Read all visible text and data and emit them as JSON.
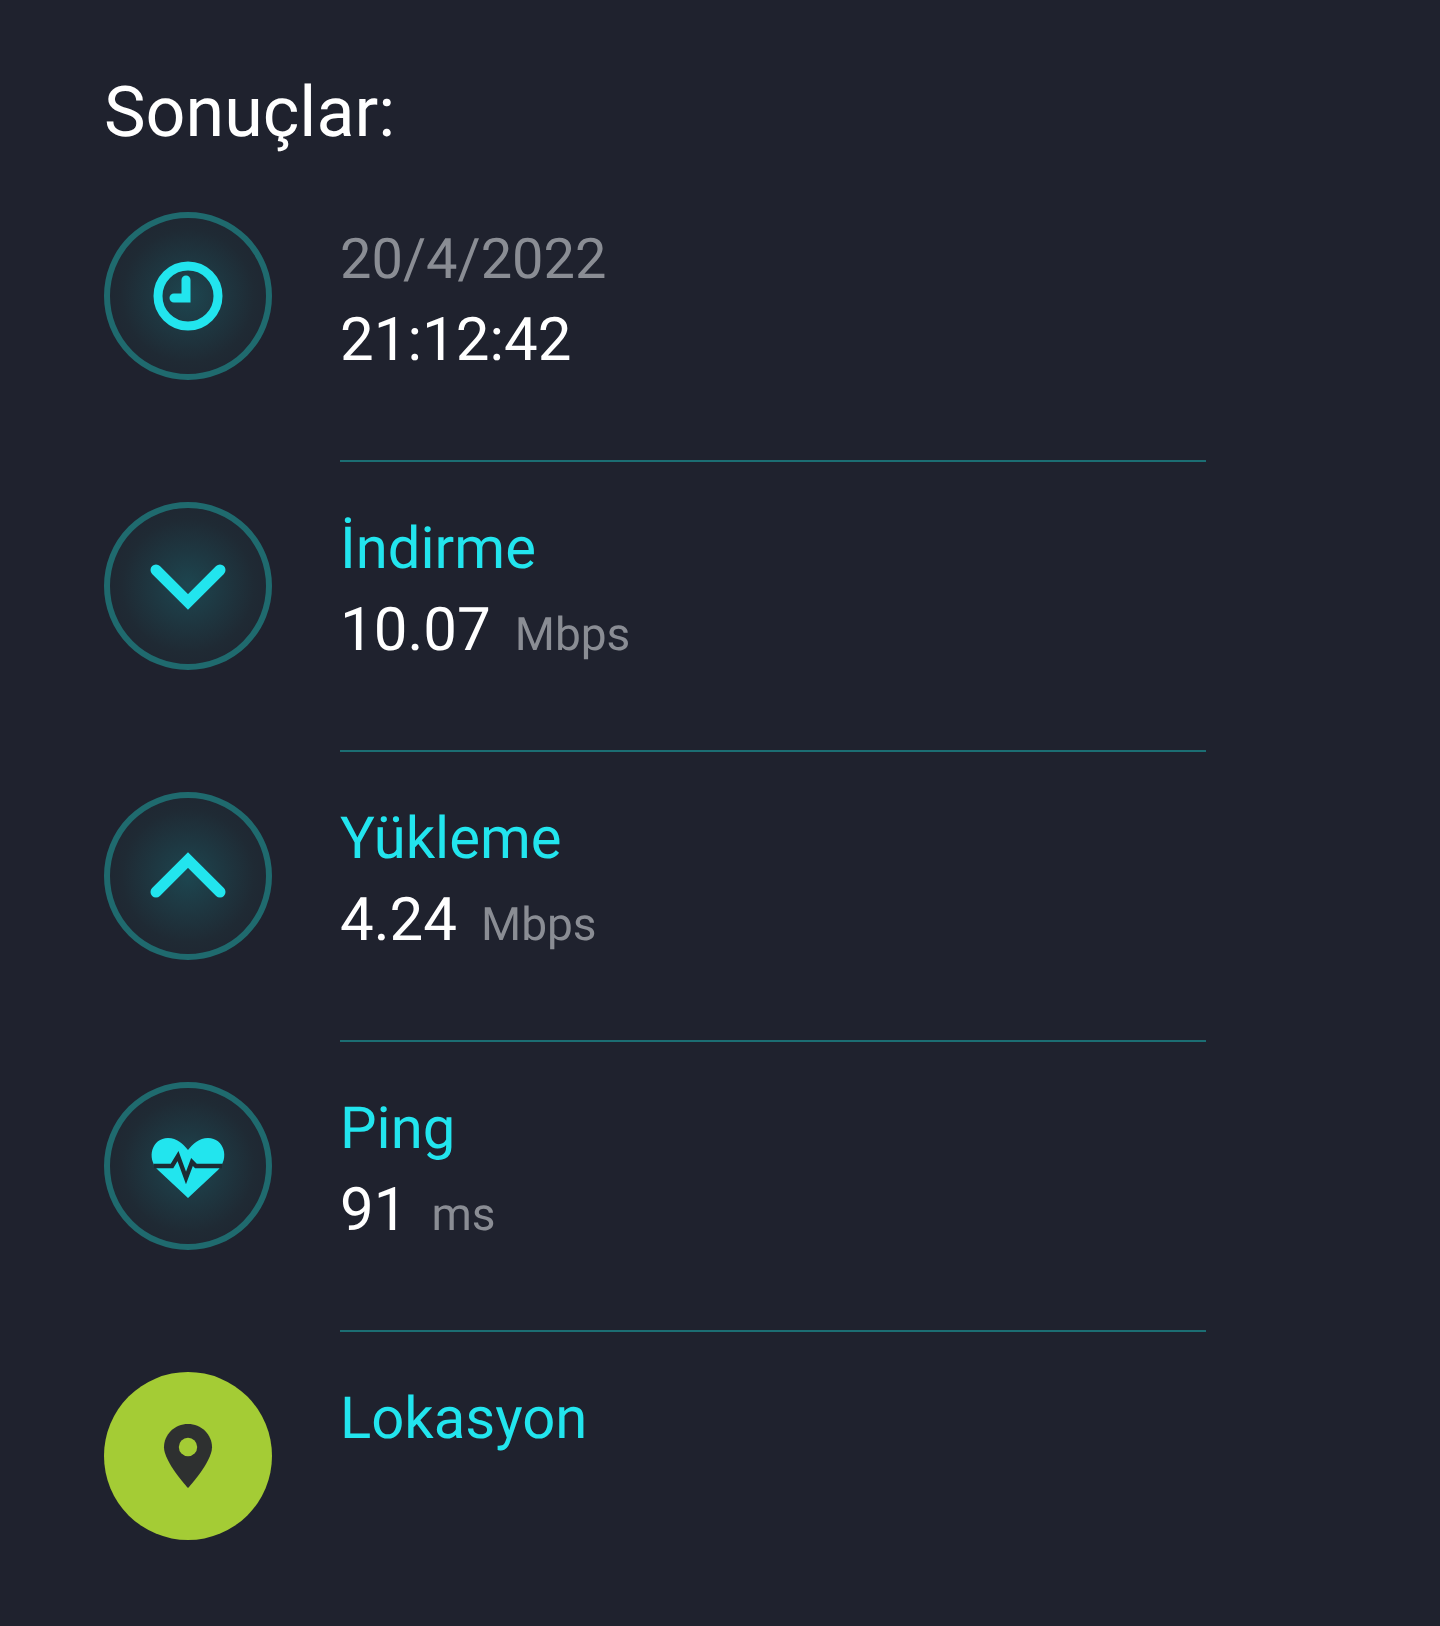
{
  "title": "Sonuçlar:",
  "results": [
    {
      "kind": "time",
      "label": "20/4/2022",
      "value": "21:12:42"
    },
    {
      "kind": "download",
      "label": "İndirme",
      "value": "10.07",
      "unit": "Mbps"
    },
    {
      "kind": "upload",
      "label": "Yükleme",
      "value": "4.24",
      "unit": "Mbps"
    },
    {
      "kind": "ping",
      "label": "Ping",
      "value": "91",
      "unit": "ms"
    },
    {
      "kind": "location",
      "label": "Lokasyon"
    }
  ]
}
